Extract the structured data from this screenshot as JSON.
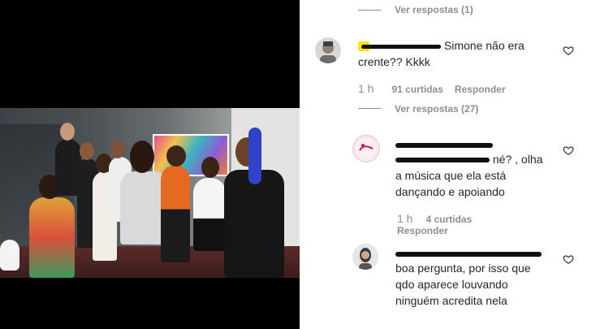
{
  "comments": [
    {
      "view_replies": "Ver respostas (1)"
    },
    {
      "text": "Simone não era crente?? Kkkk",
      "time": "1 h",
      "likes": "91 curtidas",
      "reply": "Responder",
      "view_replies": "Ver respostas (27)"
    },
    {
      "text": "né? , olha a música que ela está dançando e apoiando",
      "time": "1 h",
      "likes": "4 curtidas",
      "reply": "Responder"
    },
    {
      "text": "boa pergunta, por isso que qdo aparece louvando ninguém acredita nela"
    }
  ],
  "colors": {
    "text": "#262626",
    "secondary": "#8e8e8e",
    "highlight": "#ffe600"
  }
}
